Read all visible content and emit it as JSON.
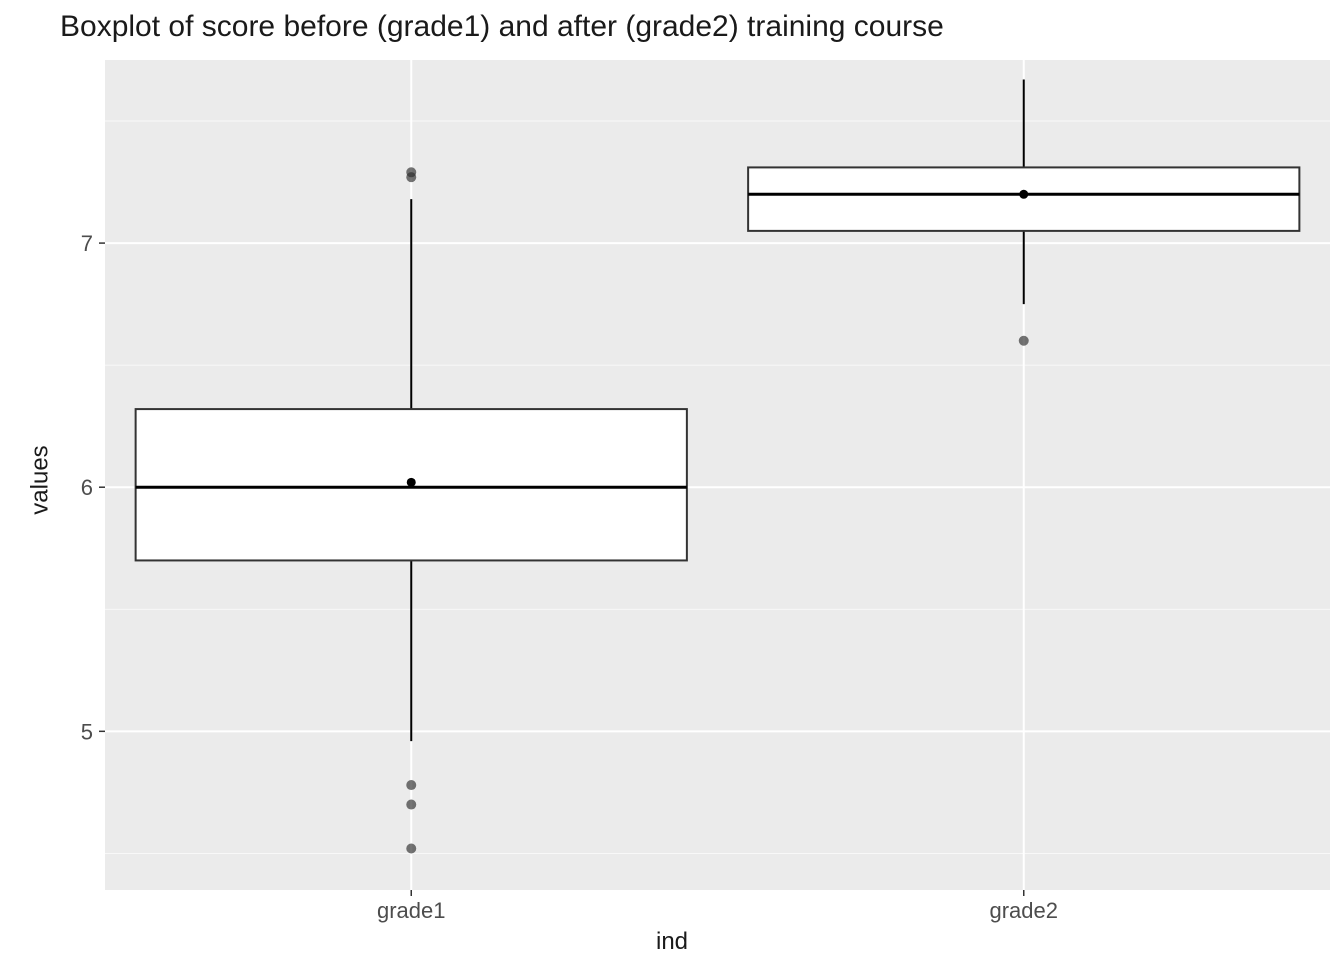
{
  "chart_data": {
    "type": "boxplot",
    "title": "Boxplot of score before (grade1) and after (grade2) training course",
    "xlabel": "ind",
    "ylabel": "values",
    "categories": [
      "grade1",
      "grade2"
    ],
    "ylim": [
      4.35,
      7.75
    ],
    "y_ticks": [
      5,
      6,
      7
    ],
    "series": [
      {
        "name": "grade1",
        "q1": 5.7,
        "median": 6.0,
        "q3": 6.32,
        "whisker_low": 4.96,
        "whisker_high": 7.18,
        "mean": 6.02,
        "outliers": [
          7.27,
          7.29,
          4.78,
          4.7,
          4.52
        ]
      },
      {
        "name": "grade2",
        "q1": 7.05,
        "median": 7.2,
        "q3": 7.31,
        "whisker_low": 6.75,
        "whisker_high": 7.67,
        "mean": 7.2,
        "outliers": [
          6.6
        ]
      }
    ],
    "colors": {
      "panel_bg": "#ebebeb",
      "grid": "#ffffff",
      "box_fill": "#ffffff",
      "box_stroke": "#333333",
      "outlier": "#2b2b2b"
    }
  }
}
